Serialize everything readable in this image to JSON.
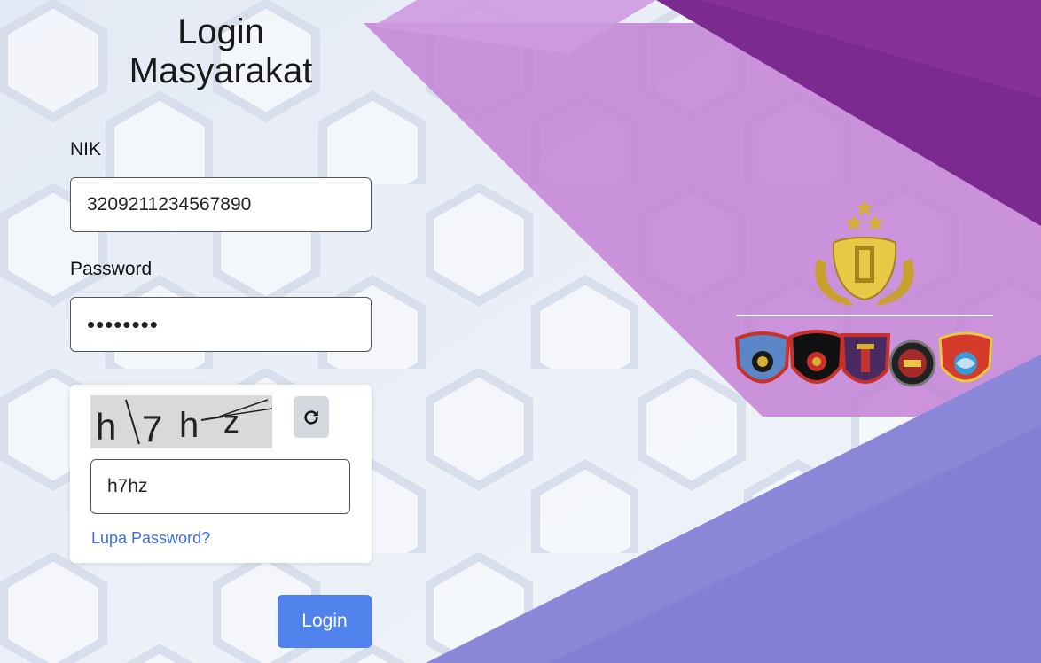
{
  "form": {
    "title_line1": "Login",
    "title_line2": "Masyarakat",
    "nik_label": "NIK",
    "nik_value": "3209211234567890",
    "password_label": "Password",
    "password_value": "password",
    "captcha_chars": [
      "h",
      "7",
      "h",
      "z"
    ],
    "captcha_value": "h7hz",
    "forgot_password": "Lupa Password?",
    "login_button": "Login"
  },
  "emblems": [
    {
      "name": "inspektorat",
      "label": "INSPEKTORAT",
      "color": "#5b87c8"
    },
    {
      "name": "bareskrim",
      "label": "BARESKRIM",
      "color": "#111111"
    },
    {
      "name": "propam",
      "label": "PROPAM",
      "color": "#4a2a63"
    },
    {
      "name": "center",
      "label": "",
      "color": "#a52a2a"
    },
    {
      "name": "tik-polri",
      "label": "TIK POLRI",
      "color": "#d63a2a"
    }
  ],
  "colors": {
    "primary_button": "#4f82ea",
    "link": "#3b6fd6",
    "purple_top": "#c888d6",
    "purple_dark": "#7a2a8f",
    "purple_bottom": "#8a84d6"
  },
  "icons": {
    "refresh": "refresh-icon",
    "main_logo": "polri-logo"
  }
}
